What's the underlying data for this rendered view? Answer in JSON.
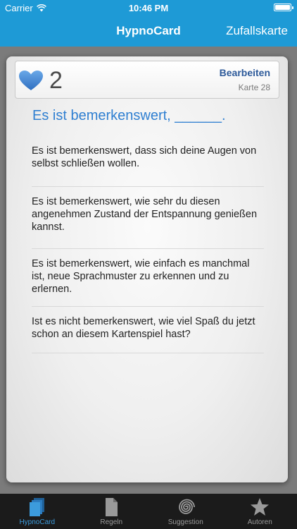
{
  "status": {
    "carrier": "Carrier",
    "time": "10:46 PM"
  },
  "nav": {
    "title": "HypnoCard",
    "random_label": "Zufallskarte"
  },
  "card": {
    "number": "2",
    "edit_label": "Bearbeiten",
    "card_label": "Karte 28",
    "title": "Es ist bemerkenswert, ______.",
    "phrases": [
      "Es ist bemerkenswert, dass sich deine Augen von selbst schließen wollen.",
      "Es ist bemerkenswert, wie sehr du diesen angenehmen Zustand der Entspannung genießen kannst.",
      "Es ist bemerkenswert, wie einfach es manchmal ist, neue Sprachmuster zu erkennen und zu erlernen.",
      "Ist es nicht bemerkenswert, wie viel Spaß du jetzt schon an diesem Kartenspiel hast?"
    ]
  },
  "tabs": [
    {
      "label": "HypnoCard",
      "icon": "cards-icon",
      "active": true
    },
    {
      "label": "Regeln",
      "icon": "document-icon",
      "active": false
    },
    {
      "label": "Suggestion",
      "icon": "spiral-icon",
      "active": false
    },
    {
      "label": "Autoren",
      "icon": "star-icon",
      "active": false
    }
  ],
  "colors": {
    "accent": "#1e9ad6",
    "title_blue": "#2f7fd1",
    "heart": "#3f86d4",
    "tab_active": "#3c9bdc"
  }
}
